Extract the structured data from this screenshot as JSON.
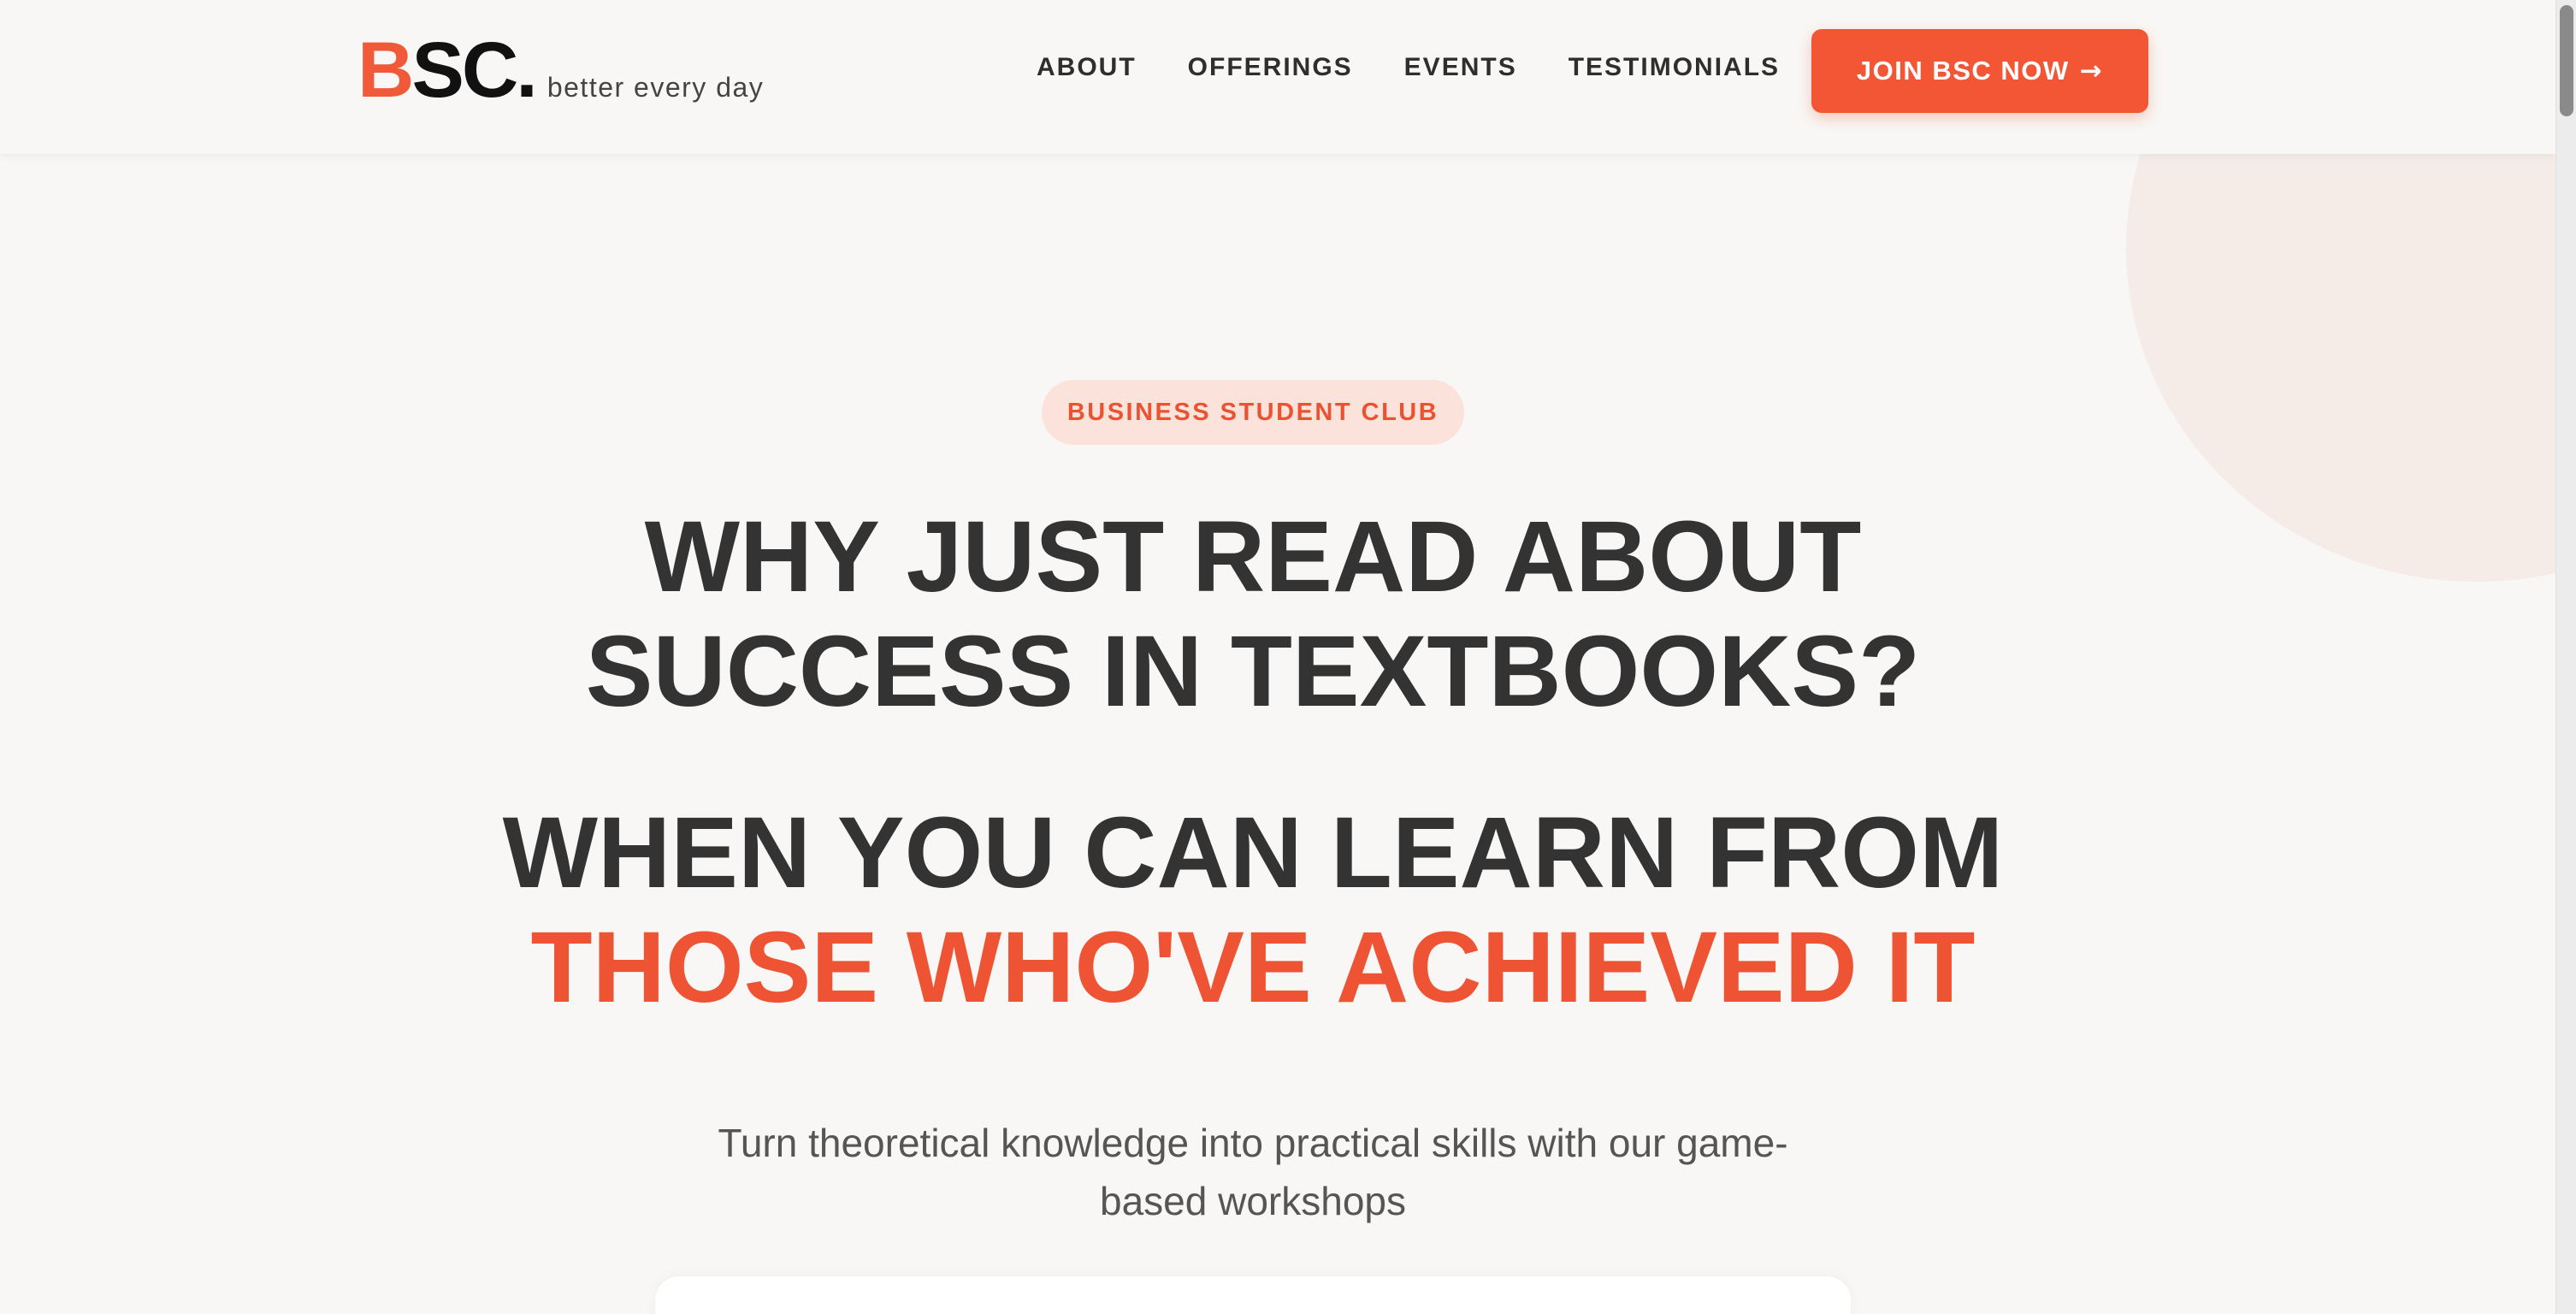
{
  "brand": {
    "logo_b": "B",
    "logo_rest": "SC.",
    "tagline": "better every day",
    "accent_color": "#f25635"
  },
  "nav": {
    "items": [
      {
        "label": "ABOUT"
      },
      {
        "label": "OFFERINGS"
      },
      {
        "label": "EVENTS"
      },
      {
        "label": "TESTIMONIALS"
      }
    ],
    "cta_label": "JOIN BSC NOW",
    "cta_arrow": "→"
  },
  "hero": {
    "badge": "BUSINESS STUDENT CLUB",
    "headline_line1": "WHY JUST READ ABOUT",
    "headline_line2": "SUCCESS IN TEXTBOOKS?",
    "subheadline_line1": "WHEN YOU CAN LEARN FROM",
    "subheadline_line2": "THOSE WHO'VE ACHIEVED IT",
    "description_line1": "Turn theoretical knowledge into practical skills with our game-",
    "description_line2": "based workshops"
  }
}
